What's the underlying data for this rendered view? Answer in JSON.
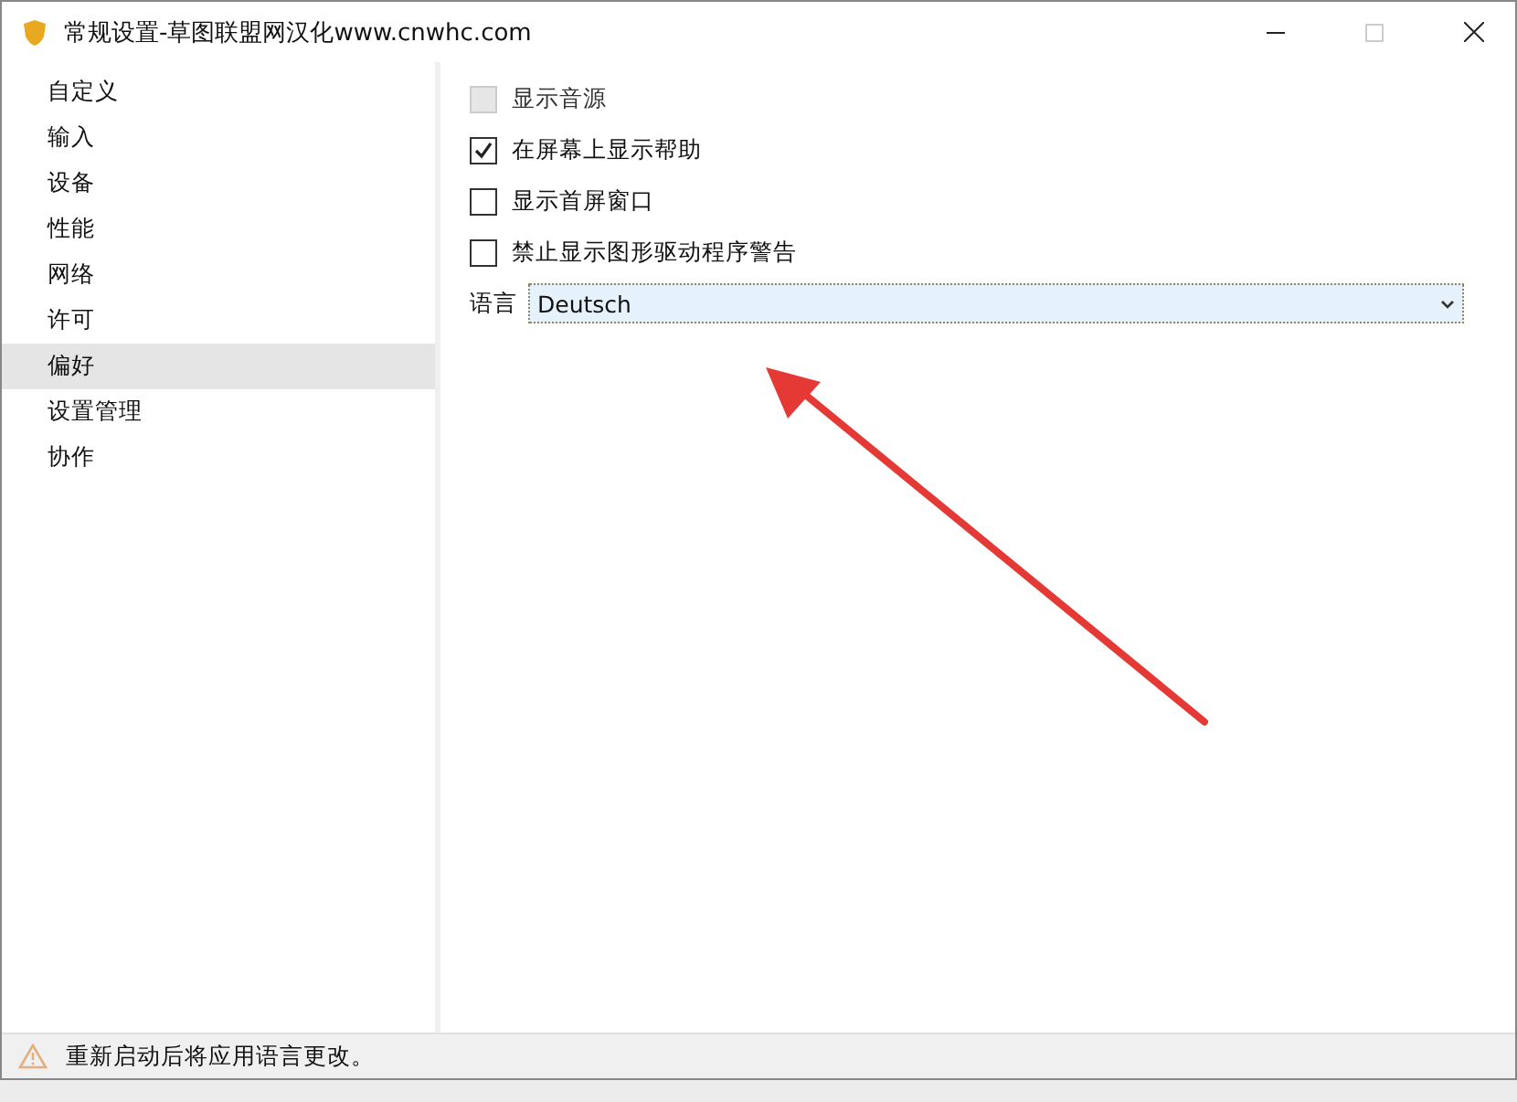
{
  "window": {
    "title": "常规设置-草图联盟网汉化www.cnwhc.com"
  },
  "sidebar": {
    "items": [
      {
        "label": "自定义",
        "selected": false
      },
      {
        "label": "输入",
        "selected": false
      },
      {
        "label": "设备",
        "selected": false
      },
      {
        "label": "性能",
        "selected": false
      },
      {
        "label": "网络",
        "selected": false
      },
      {
        "label": "许可",
        "selected": false
      },
      {
        "label": "偏好",
        "selected": true
      },
      {
        "label": "设置管理",
        "selected": false
      },
      {
        "label": "协作",
        "selected": false
      }
    ]
  },
  "options": [
    {
      "label": "显示音源",
      "checked": false,
      "disabled": true
    },
    {
      "label": "在屏幕上显示帮助",
      "checked": true,
      "disabled": false
    },
    {
      "label": "显示首屏窗口",
      "checked": false,
      "disabled": false
    },
    {
      "label": "禁止显示图形驱动程序警告",
      "checked": false,
      "disabled": false
    }
  ],
  "language": {
    "label": "语言",
    "value": "Deutsch"
  },
  "status_bar": {
    "message": "重新启动后将应用语言更改。"
  }
}
